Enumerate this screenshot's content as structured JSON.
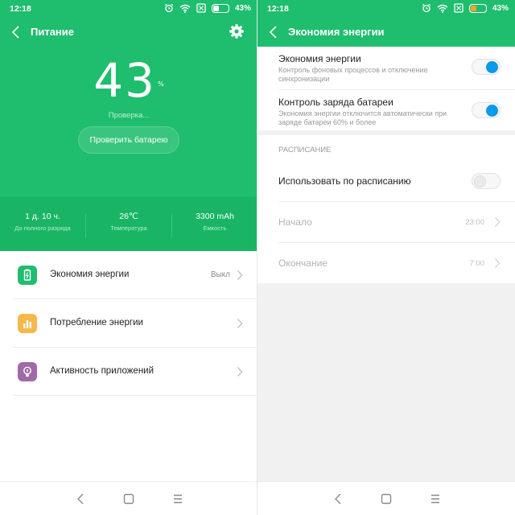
{
  "left": {
    "status": {
      "time": "12:18",
      "battery_percent": "43%",
      "battery_level": 0.43
    },
    "header": {
      "title": "Питание"
    },
    "battery": {
      "value": "43",
      "unit": "%",
      "status": "Проверка...",
      "check_button": "Проверить батарею"
    },
    "stats": [
      {
        "value": "1 д. 10 ч.",
        "label": "До полного разряда"
      },
      {
        "value": "26℃",
        "label": "Температура"
      },
      {
        "value": "3300 mAh",
        "label": "Емкость"
      }
    ],
    "menu": [
      {
        "label": "Экономия энергии",
        "value": "Выкл",
        "icon": "battery-saver-icon",
        "color": "#1fbd6e"
      },
      {
        "label": "Потребление энергии",
        "value": "",
        "icon": "bar-chart-icon",
        "color": "#f7b84b"
      },
      {
        "label": "Активность приложений",
        "value": "",
        "icon": "bulb-icon",
        "color": "#a06aa8"
      }
    ]
  },
  "right": {
    "status": {
      "time": "12:18",
      "battery_percent": "43%",
      "battery_level": 0.43
    },
    "header": {
      "title": "Экономия энергии"
    },
    "toggles": [
      {
        "title": "Экономия энергии",
        "subtitle": "Контроль фоновых процессов и отключение синхронизации",
        "on": true
      },
      {
        "title": "Контроль заряда батареи",
        "subtitle": "Экономия энергии отключится автоматически при заряде батареи 60% и более",
        "on": true
      }
    ],
    "schedule": {
      "header": "РАСПИСАНИЕ",
      "use_label": "Использовать по расписанию",
      "use_on": false,
      "start_label": "Начало",
      "start_time": "23:00",
      "end_label": "Окончание",
      "end_time": "7:00"
    }
  },
  "colors": {
    "accent": "#1fbd6e",
    "toggle_on": "#0a9aea",
    "battery_orange": "#f5a623"
  }
}
